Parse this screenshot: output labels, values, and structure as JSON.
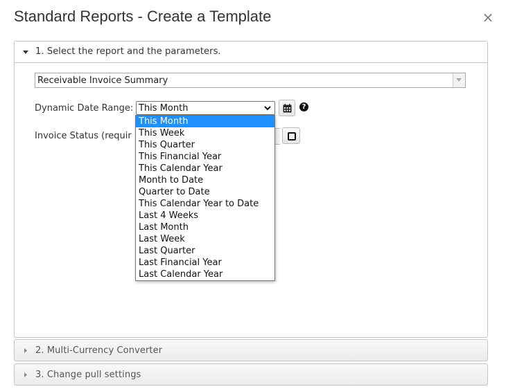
{
  "dialog": {
    "title": "Standard Reports - Create a Template",
    "close_label": "×"
  },
  "sections": {
    "s1": {
      "label": "1. Select the report and the parameters.",
      "expanded": true
    },
    "s2": {
      "label": "2. Multi-Currency Converter",
      "expanded": false
    },
    "s3": {
      "label": "3. Change pull settings",
      "expanded": false
    }
  },
  "report": {
    "selected": "Receivable Invoice Summary"
  },
  "date_range": {
    "label": "Dynamic Date Range:",
    "selected": "This Month",
    "help_label": "?",
    "options": [
      "This Month",
      "This Week",
      "This Quarter",
      "This Financial Year",
      "This Calendar Year",
      "Month to Date",
      "Quarter to Date",
      "This Calendar Year to Date",
      "Last 4 Weeks",
      "Last Month",
      "Last Week",
      "Last Quarter",
      "Last Financial Year",
      "Last Calendar Year"
    ]
  },
  "invoice_status": {
    "label": "Invoice Status (requir"
  },
  "icons": {
    "close": "close-icon",
    "expanded": "triangle-down-icon",
    "collapsed": "triangle-right-icon",
    "calendar": "calendar-icon",
    "help": "question-circle-icon",
    "status": "square-icon"
  },
  "colors": {
    "selected_option": "#1e90ff",
    "border": "#c5c5c5"
  }
}
